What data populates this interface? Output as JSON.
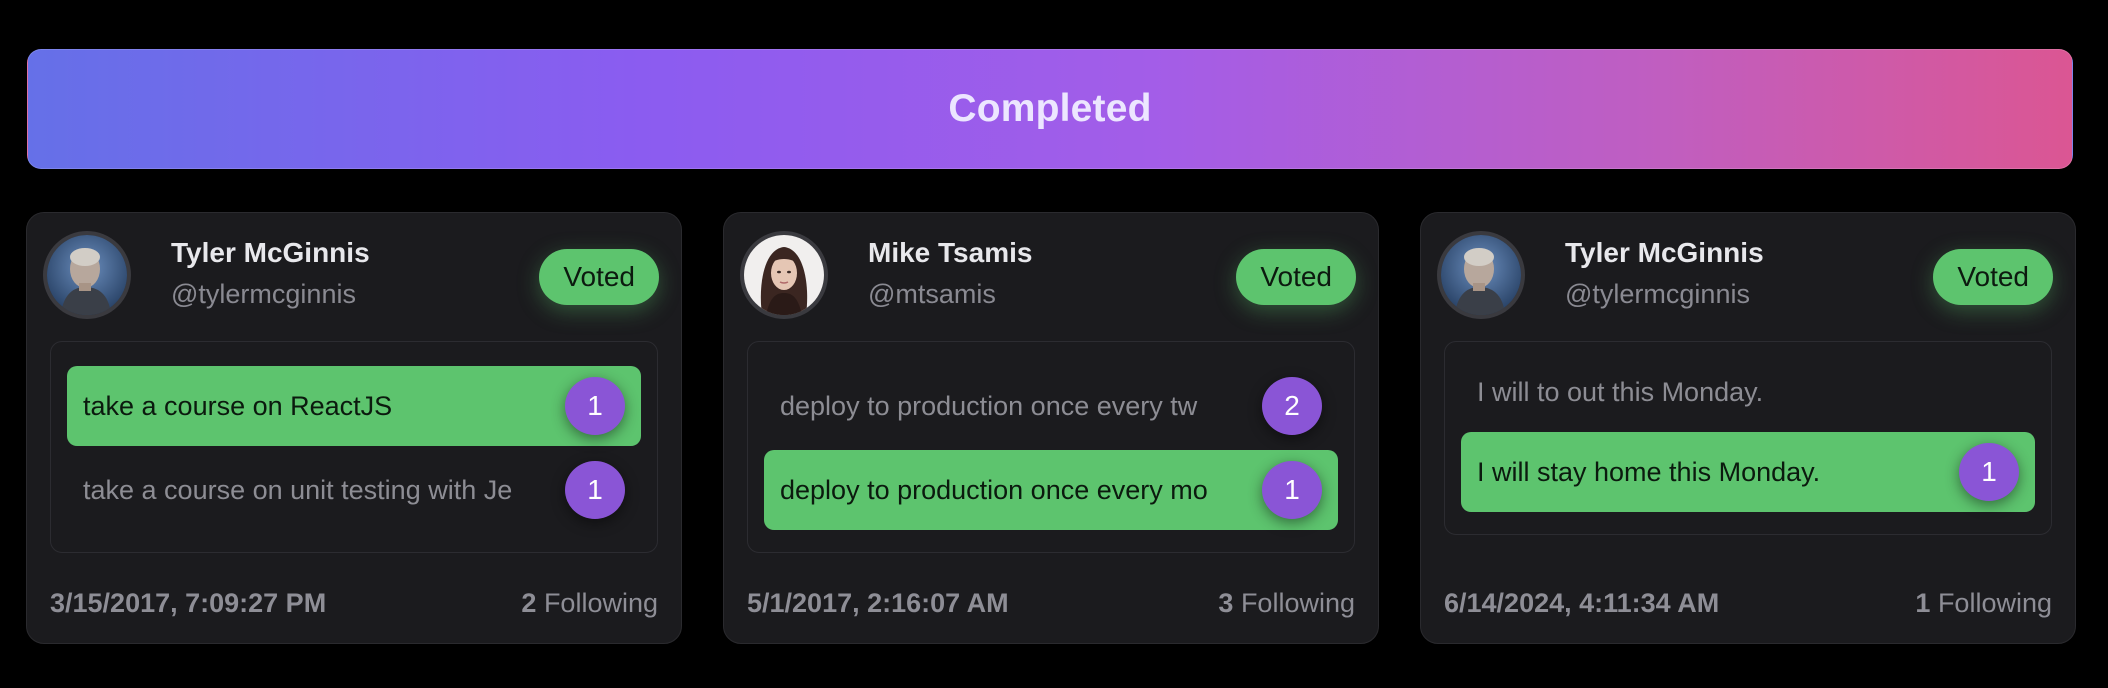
{
  "banner": {
    "title": "Completed"
  },
  "cards": [
    {
      "name": "Tyler McGinnis",
      "handle": "@tylermcginnis",
      "avatar": "male-portrait",
      "status": "Voted",
      "options": [
        {
          "text": "take a course on ReactJS",
          "count": "1",
          "selected": true
        },
        {
          "text": "take a course on unit testing with Je",
          "count": "1",
          "selected": false
        }
      ],
      "timestamp": "3/15/2017, 7:09:27 PM",
      "following_count": "2",
      "following_label": "Following"
    },
    {
      "name": "Mike Tsamis",
      "handle": "@mtsamis",
      "avatar": "female-portrait",
      "status": "Voted",
      "options": [
        {
          "text": "deploy to production once every tw",
          "count": "2",
          "selected": false
        },
        {
          "text": "deploy to production once every mo",
          "count": "1",
          "selected": true
        }
      ],
      "timestamp": "5/1/2017, 2:16:07 AM",
      "following_count": "3",
      "following_label": "Following"
    },
    {
      "name": "Tyler McGinnis",
      "handle": "@tylermcginnis",
      "avatar": "male-portrait",
      "status": "Voted",
      "options": [
        {
          "text": "I will to out this Monday.",
          "count": "",
          "selected": false
        },
        {
          "text": "I will stay home this Monday.",
          "count": "1",
          "selected": true
        }
      ],
      "timestamp": "6/14/2024, 4:11:34 AM",
      "following_count": "1",
      "following_label": "Following"
    }
  ],
  "colors": {
    "selected_option": "#5dc46e",
    "count_badge": "#8a55d6",
    "gradient_start": "#6570e8",
    "gradient_end": "#db5693"
  }
}
